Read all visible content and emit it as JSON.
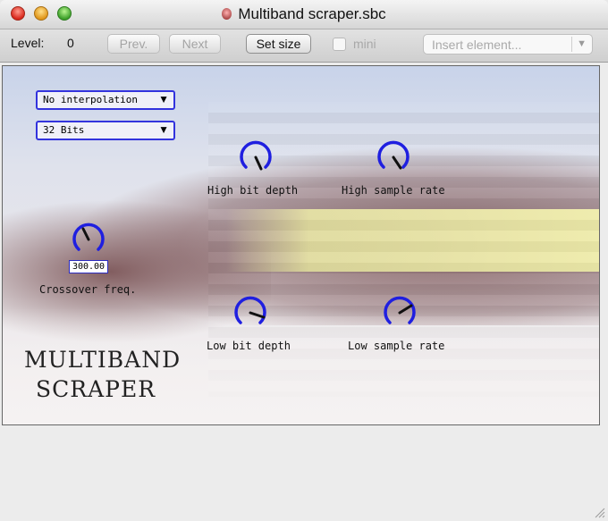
{
  "window": {
    "title": "Multiband scraper.sbc"
  },
  "toolbar": {
    "level_label": "Level:",
    "level_value": "0",
    "prev_label": "Prev.",
    "next_label": "Next",
    "set_size_label": "Set size",
    "mini_label": "mini",
    "insert_element_placeholder": "Insert element..."
  },
  "controls": {
    "interpolation_value": "No interpolation",
    "bits_value": "32 Bits",
    "crossover_value": "300.00"
  },
  "knobs": {
    "high_bit_depth": "High bit depth",
    "high_sample_rate": "High sample rate",
    "crossover_freq": "Crossover freq.",
    "low_bit_depth": "Low bit depth",
    "low_sample_rate": "Low sample rate"
  },
  "logo": {
    "line1": "MULTIBAND",
    "line2": "SCRAPER"
  },
  "colors": {
    "knob_blue": "#1f1fe0",
    "select_border": "#3333dd"
  }
}
